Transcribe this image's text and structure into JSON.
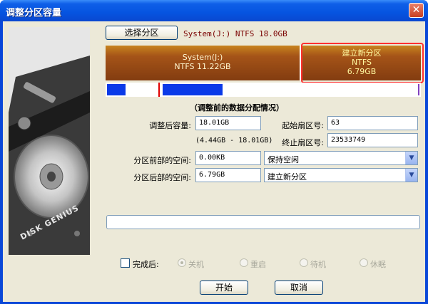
{
  "window": {
    "title": "调整分区容量",
    "close_glyph": "✕"
  },
  "side_panel": {
    "brand_text": "DISK GENIUS"
  },
  "toolbar": {
    "select_partition_label": "选择分区",
    "partition_info": "System(J:) NTFS 18.0GB"
  },
  "partition_bar": {
    "segments": [
      {
        "name": "System(J:)",
        "fs": "NTFS",
        "size": "11.22GB"
      },
      {
        "name": "建立新分区",
        "fs": "NTFS",
        "size": "6.79GB"
      }
    ],
    "usage_colors": {
      "used": "#0a3ae8",
      "marker": "#e00000"
    }
  },
  "section_title": "（调整前的数据分配情况）",
  "form": {
    "new_size_label": "调整后容量:",
    "new_size_value": "18.01GB",
    "range": "(4.44GB - 18.01GB)",
    "start_sector_label": "起始扇区号:",
    "start_sector_value": "63",
    "end_sector_label": "终止扇区号:",
    "end_sector_value": "23533749",
    "before_space_label": "分区前部的空间:",
    "before_space_value": "0.00KB",
    "before_space_option": "保持空闲",
    "after_space_label": "分区后部的空间:",
    "after_space_value": "6.79GB",
    "after_space_option": "建立新分区"
  },
  "progress": {
    "fraction": 0
  },
  "completion": {
    "checkbox_label": "完成后:",
    "options": [
      "关机",
      "重启",
      "待机",
      "休眠"
    ]
  },
  "buttons": {
    "start": "开始",
    "cancel": "取消"
  }
}
